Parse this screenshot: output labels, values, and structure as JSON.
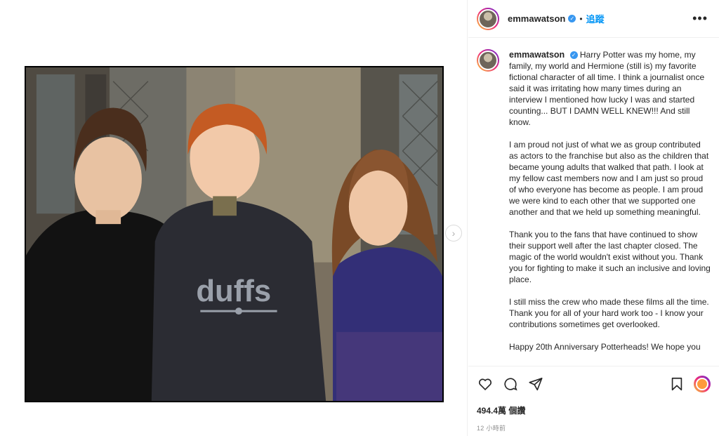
{
  "header": {
    "username": "emmawatson",
    "verified_glyph": "✓",
    "separator": "•",
    "follow_label": "追蹤",
    "more_label": "•••"
  },
  "caption": {
    "username": "emmawatson",
    "paragraphs": [
      "Harry Potter was my home, my family, my world and Hermione (still is) my favorite fictional character of all time. I think a journalist once said it was irritating how many times during an interview I mentioned how lucky I was and started counting... BUT I DAMN WELL KNEW!!! And still know.",
      "I am proud not just of what we as group contributed as actors to the franchise but also as the children that became young adults that walked that path. I look at my fellow cast members now and I am just so proud of who everyone has become as people. I am proud we were kind to each other that we supported one another and that we held up something meaningful.",
      "Thank you to the fans that have continued to show their support well after the last chapter closed. The magic of the world wouldn't exist without you. Thank you for fighting to make it such an inclusive and loving place.",
      "I still miss the crew who made these films all the time. Thank you for all of your hard work too - I know your contributions sometimes get overlooked.",
      "Happy 20th Anniversary Potterheads! We hope you"
    ]
  },
  "media": {
    "next_glyph": "›",
    "hoodie_text": "duffs"
  },
  "actions": {
    "icons": [
      "heart-icon",
      "comment-icon",
      "share-icon",
      "bookmark-icon"
    ],
    "views_label": "494.4萬 個讚",
    "timestamp": "12 小時前"
  },
  "colors": {
    "accent": "#0095f6",
    "verified": "#3897f0",
    "muted": "#8e8e8e"
  }
}
